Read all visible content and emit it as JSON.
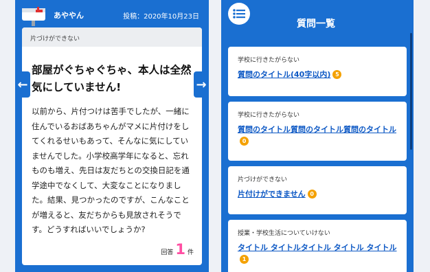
{
  "left": {
    "author": "あややん",
    "posted_prefix": "投稿：",
    "posted_date": "2020年10月23日",
    "category": "片づけができない",
    "title": "部屋がぐちゃぐちゃ、本人は全然気にしていません!",
    "body": "以前から、片付つけは苦手でしたが、一緒に住んでいるおばあちゃんがマメに片付けをしてくれるせいもあって、そんなに気にしていませんでした。小学校高学年になると、忘れものも増え、先日は友だちとの交換日記を通学途中でなくして、大変なことになりました。結果、見つかったのですが、こんなことが増えると、友だちからも見放されそうです。どうすればいいでしょうか?",
    "answers_prefix": "回答",
    "answers_count": "1",
    "answers_suffix": "件",
    "prev_icon": "←",
    "next_icon": "→"
  },
  "right": {
    "title": "質問一覧",
    "questions": [
      {
        "category": "学校に行きたがらない",
        "title": "質問のタイトル(40字以内)",
        "count": "5"
      },
      {
        "category": "学校に行きたがらない",
        "title": "質問のタイトル質問のタイトル質問のタイトル",
        "count": "0"
      },
      {
        "category": "片づけができない",
        "title": "片付けができません",
        "count": "0"
      },
      {
        "category": "授業・学校生活についていけない",
        "title": "タイトル タイトルタイトル タイトル タイトル",
        "count": "1"
      }
    ]
  },
  "colors": {
    "primary": "#1a6fd1",
    "badge": "#f4a100",
    "accent_count": "#ff4fa3",
    "link": "#0b57c4"
  }
}
